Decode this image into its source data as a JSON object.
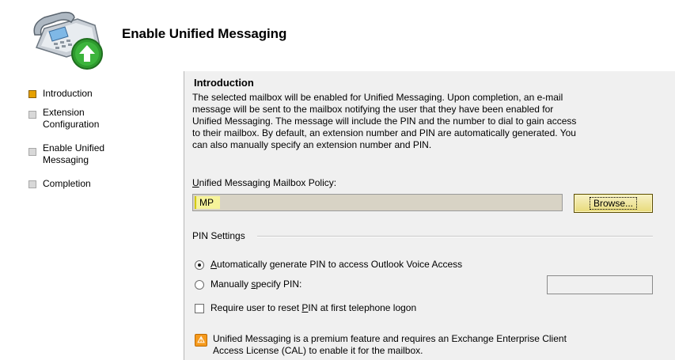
{
  "header": {
    "title": "Enable Unified Messaging"
  },
  "steps": [
    {
      "label_lines": [
        "Introduction"
      ],
      "active": true
    },
    {
      "label_lines": [
        "Extension",
        "Configuration"
      ],
      "active": false
    },
    {
      "label_lines": [
        "Enable Unified",
        "Messaging"
      ],
      "active": false
    },
    {
      "label_lines": [
        "Completion"
      ],
      "active": false
    }
  ],
  "main": {
    "section_title": "Introduction",
    "description_lines": [
      "The selected mailbox will be enabled for Unified Messaging. Upon completion, an e-mail",
      "message will be sent to the mailbox notifying the user that they have been enabled for",
      "Unified Messaging. The message will include the PIN and the number to dial to gain access",
      "to their mailbox. By default, an extension number and PIN are automatically generated. You",
      "can also manually specify an extension number and PIN."
    ],
    "policy": {
      "label_accel": "U",
      "label_rest": "nified Messaging Mailbox Policy:",
      "value": "MP",
      "browse_label": "Browse..."
    },
    "pin_settings": {
      "group_label": "PIN Settings",
      "auto_option": {
        "accel": "A",
        "rest": "utomatically generate PIN to access Outlook Voice Access",
        "checked": true
      },
      "manual_option": {
        "pre": "Manually ",
        "accel": "s",
        "post": "pecify PIN:",
        "checked": false
      },
      "manual_value": "",
      "reset_option": {
        "pre": "Require user to reset ",
        "accel": "P",
        "post": "IN at first telephone logon",
        "checked": false
      }
    },
    "warning": {
      "icon_glyph": "⚠",
      "lines": [
        "Unified Messaging is a premium feature and requires an Exchange Enterprise Client",
        "Access License (CAL) to enable it for the mailbox."
      ]
    }
  },
  "colors": {
    "active_step": "#e6a100",
    "policy_highlight": "#f6f39a",
    "warning": "#f59a1d"
  },
  "icons": {
    "header": "phone-enable-icon",
    "warning": "warning-icon"
  }
}
